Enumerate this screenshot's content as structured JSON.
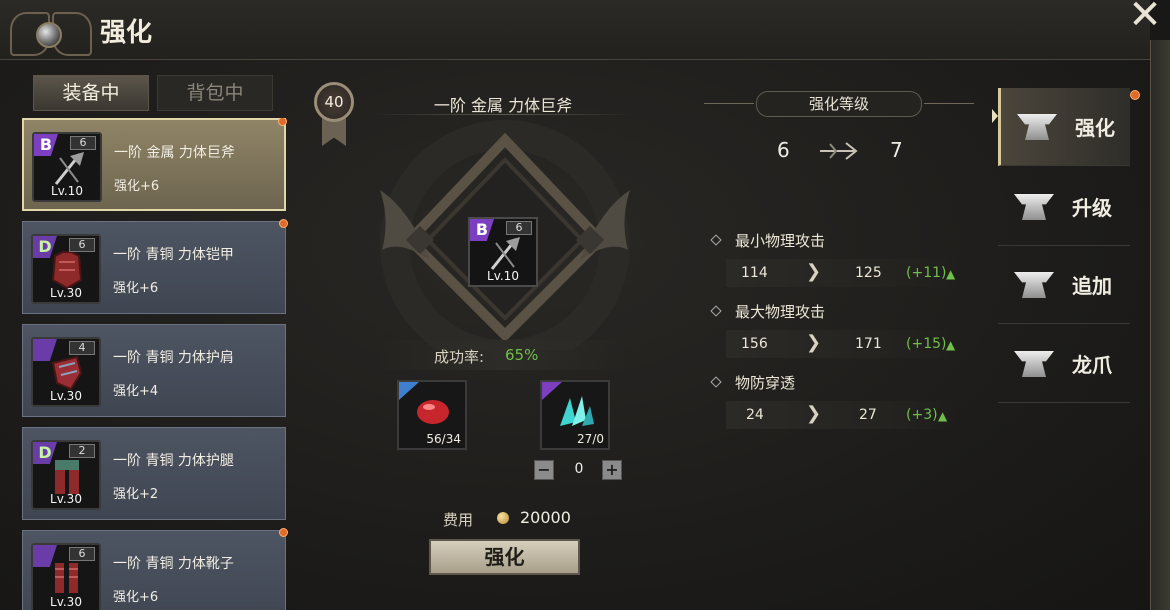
{
  "header": {
    "title": "强化",
    "close_glyph": "✕"
  },
  "tabs": [
    {
      "label": "装备中",
      "active": true
    },
    {
      "label": "背包中",
      "active": false
    }
  ],
  "equipment": [
    {
      "grade": "B",
      "stars": "6",
      "level": "Lv.10",
      "name": "一阶 金属 力体巨斧",
      "enhance": "强化+6",
      "selected": true,
      "notify": true
    },
    {
      "grade": "D",
      "stars": "6",
      "level": "Lv.30",
      "name": "一阶 青铜 力体铠甲",
      "enhance": "强化+6",
      "selected": false,
      "notify": true
    },
    {
      "grade": "",
      "stars": "4",
      "level": "Lv.30",
      "name": "一阶 青铜 力体护肩",
      "enhance": "强化+4",
      "selected": false,
      "notify": false
    },
    {
      "grade": "D",
      "stars": "2",
      "level": "Lv.30",
      "name": "一阶 青铜 力体护腿",
      "enhance": "强化+2",
      "selected": false,
      "notify": false
    },
    {
      "grade": "",
      "stars": "6",
      "level": "Lv.30",
      "name": "一阶 青铜 力体靴子",
      "enhance": "强化+6",
      "selected": false,
      "notify": true
    }
  ],
  "center": {
    "rank": "40",
    "item_title": "一阶 金属 力体巨斧",
    "item_grade": "B",
    "item_stars": "6",
    "item_level": "Lv.10",
    "success_label": "成功率:",
    "success_value": "65%",
    "materials": [
      {
        "count": "56/34",
        "corner_color": "#3f7fd0"
      },
      {
        "count": "27/0",
        "corner_color": "#7b3fbf"
      }
    ],
    "stepper": {
      "minus": "−",
      "value": "0",
      "plus": "+"
    },
    "cost_label": "费用",
    "cost_value": "20000",
    "enhance_button": "强化"
  },
  "level_panel": {
    "title": "强化等级",
    "from": "6",
    "to": "7"
  },
  "stats": [
    {
      "name": "最小物理攻击",
      "current": "114",
      "next": "125",
      "delta": "(+11)"
    },
    {
      "name": "最大物理攻击",
      "current": "156",
      "next": "171",
      "delta": "(+15)"
    },
    {
      "name": "物防穿透",
      "current": "24",
      "next": "27",
      "delta": "(+3)"
    }
  ],
  "side_menu": [
    {
      "label": "强化",
      "active": true
    },
    {
      "label": "升级",
      "active": false
    },
    {
      "label": "追加",
      "active": false
    },
    {
      "label": "龙爪",
      "active": false
    }
  ],
  "colors": {
    "accent_gold": "#d8c99a",
    "positive": "#6fbf4a",
    "notify": "#e06a2a"
  }
}
